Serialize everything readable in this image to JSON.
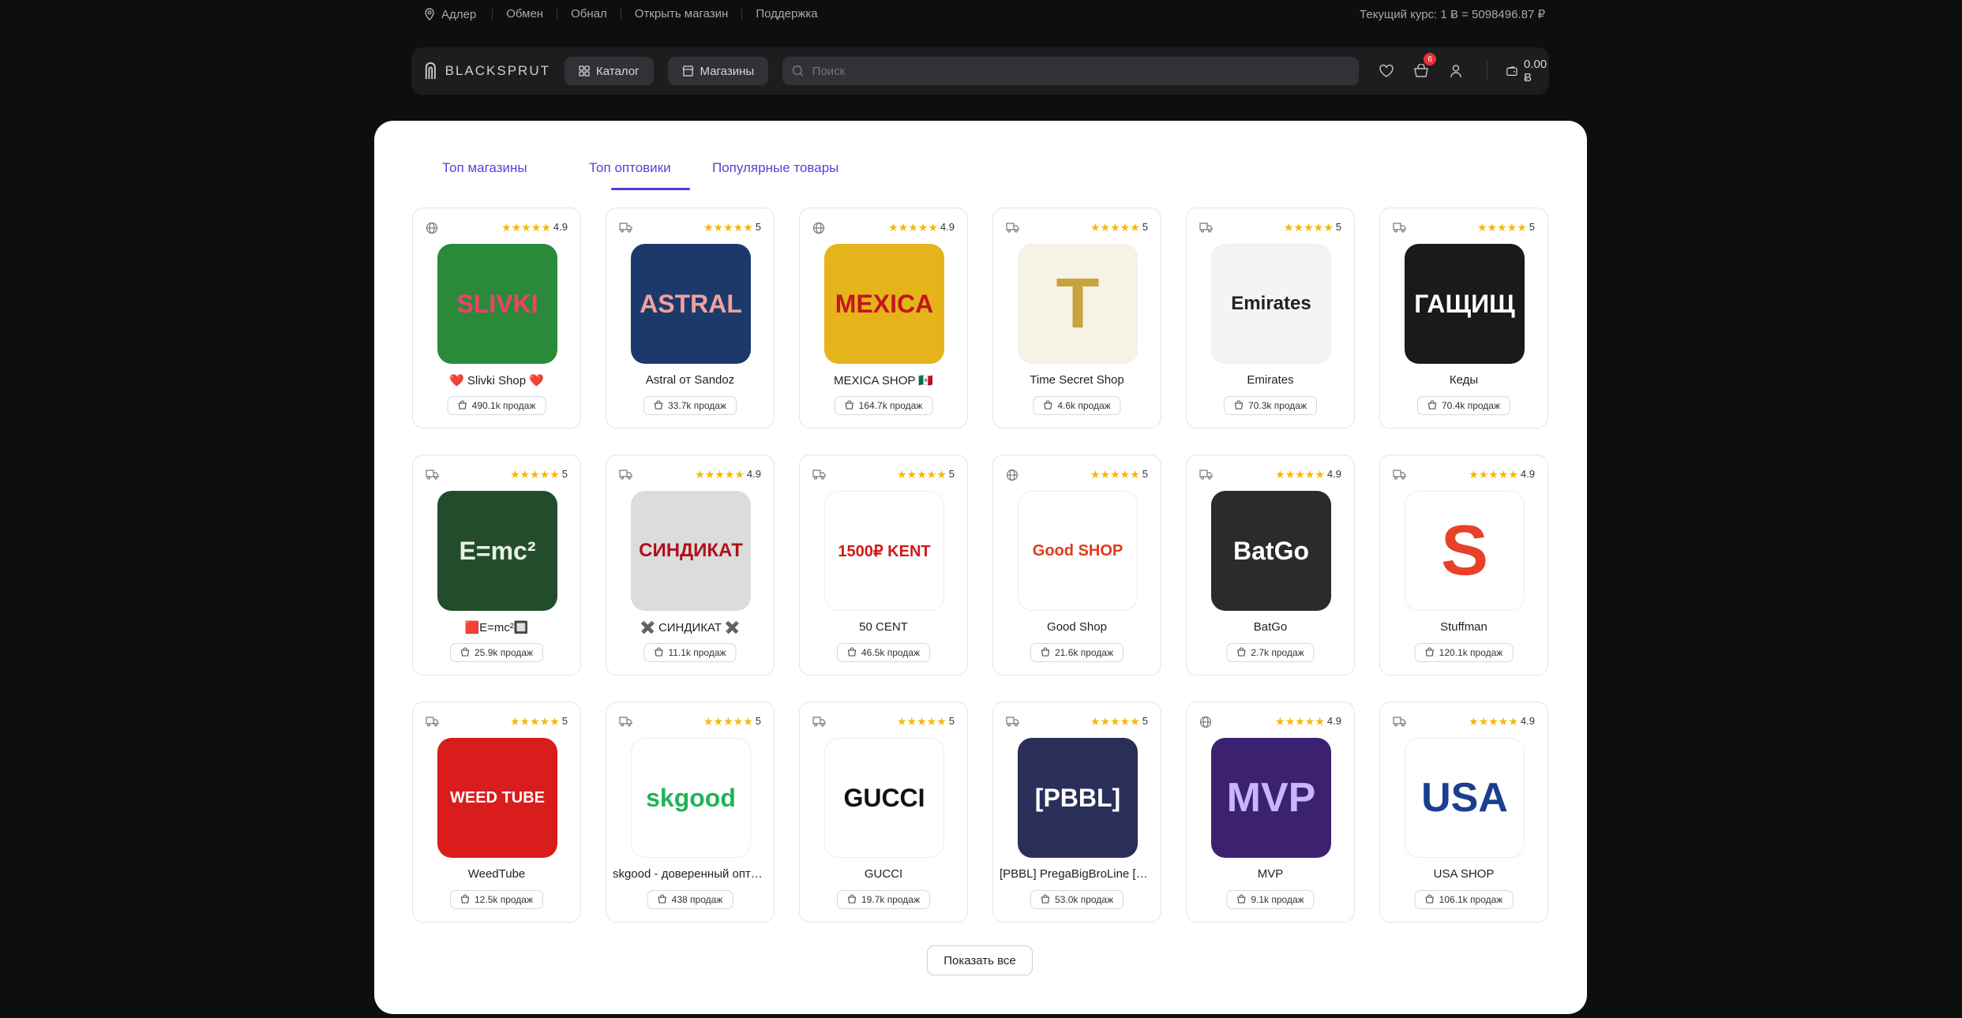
{
  "topbar": {
    "location": "Адлер",
    "links": [
      "Обмен",
      "Обнал",
      "Открыть магазин",
      "Поддержка"
    ],
    "rate": "Текущий курс: 1 Ƀ = 5098496.87 ₽"
  },
  "header": {
    "logo": "BLACKSPRUT",
    "catalog": "Каталог",
    "shops": "Магазины",
    "search_placeholder": "Поиск",
    "cart_badge": "6",
    "balance": "0.00 Ƀ"
  },
  "tabs": [
    "Топ магазины",
    "Топ оптовики",
    "Популярные товары"
  ],
  "active_tab": 1,
  "stars": "★★★★★",
  "cards": [
    {
      "name": "❤️ Slivki Shop ❤️",
      "rating": "4.9",
      "sales": "490.1k продаж",
      "type": "globe",
      "thumb_text": "SLIVKI",
      "bg": "#2a8a3a",
      "fg": "#ff3b6b"
    },
    {
      "name": "Astral от Sandoz",
      "rating": "5",
      "sales": "33.7k продаж",
      "type": "truck",
      "thumb_text": "ASTRAL",
      "bg": "#1b3a6b",
      "fg": "#f2a0a0"
    },
    {
      "name": "MEXICA SHOP 🇲🇽",
      "rating": "4.9",
      "sales": "164.7k продаж",
      "type": "globe",
      "thumb_text": "MEXICA",
      "bg": "#e5b31a",
      "fg": "#c4161c"
    },
    {
      "name": "Time Secret Shop",
      "rating": "5",
      "sales": "4.6k продаж",
      "type": "truck",
      "thumb_text": "T",
      "bg": "#f7f2e6",
      "fg": "#c9a33b"
    },
    {
      "name": "Emirates",
      "rating": "5",
      "sales": "70.3k продаж",
      "type": "truck",
      "thumb_text": "Emirates",
      "bg": "#f4f4f4",
      "fg": "#222"
    },
    {
      "name": "Кеды",
      "rating": "5",
      "sales": "70.4k продаж",
      "type": "truck",
      "thumb_text": "ГАЩИЩ",
      "bg": "#1a1a1a",
      "fg": "#fff"
    },
    {
      "name": "🟥E=mc²🔲",
      "rating": "5",
      "sales": "25.9k продаж",
      "type": "truck",
      "thumb_text": "E=mc²",
      "bg": "#234d2a",
      "fg": "#e8f0e8"
    },
    {
      "name": "✖️ СИНДИКАТ ✖️",
      "rating": "4.9",
      "sales": "11.1k продаж",
      "type": "truck",
      "thumb_text": "СИНДИКАТ",
      "bg": "#dcdcdc",
      "fg": "#b0101a"
    },
    {
      "name": "50 CENT",
      "rating": "5",
      "sales": "46.5k продаж",
      "type": "truck",
      "thumb_text": "1500₽ KENT",
      "bg": "#ffffff",
      "fg": "#d01818"
    },
    {
      "name": "Good Shop",
      "rating": "5",
      "sales": "21.6k продаж",
      "type": "globe",
      "thumb_text": "Good SHOP",
      "bg": "#ffffff",
      "fg": "#e23a1a"
    },
    {
      "name": "BatGo",
      "rating": "4.9",
      "sales": "2.7k продаж",
      "type": "truck",
      "thumb_text": "BatGo",
      "bg": "#2b2b2b",
      "fg": "#ffffff"
    },
    {
      "name": "Stuffman",
      "rating": "4.9",
      "sales": "120.1k продаж",
      "type": "truck",
      "thumb_text": "S",
      "bg": "#ffffff",
      "fg": "#e8412a"
    },
    {
      "name": "WeedTube",
      "rating": "5",
      "sales": "12.5k продаж",
      "type": "truck",
      "thumb_text": "WEED TUBE",
      "bg": "#d91c1c",
      "fg": "#ffffff"
    },
    {
      "name": "skgood - доверенный оптовик",
      "rating": "5",
      "sales": "438 продаж",
      "type": "truck",
      "thumb_text": "skgood",
      "bg": "#ffffff",
      "fg": "#22b35a"
    },
    {
      "name": "GUCCI",
      "rating": "5",
      "sales": "19.7k продаж",
      "type": "truck",
      "thumb_text": "GUCCI",
      "bg": "#ffffff",
      "fg": "#111111"
    },
    {
      "name": "[PBBL] PregaBigBroLine [Прега]",
      "rating": "5",
      "sales": "53.0k продаж",
      "type": "truck",
      "thumb_text": "[PBBL]",
      "bg": "#2a2f5a",
      "fg": "#ffffff"
    },
    {
      "name": "MVP",
      "rating": "4.9",
      "sales": "9.1k продаж",
      "type": "globe",
      "thumb_text": "MVP",
      "bg": "#3b2170",
      "fg": "#c9b4ff"
    },
    {
      "name": "USA SHOP",
      "rating": "4.9",
      "sales": "106.1k продаж",
      "type": "truck",
      "thumb_text": "USA",
      "bg": "#ffffff",
      "fg": "#1b3f8f"
    }
  ],
  "show_all": "Показать все",
  "colors": {
    "accent": "#4b3ed8",
    "star": "#f5b800",
    "badge": "#e5313b"
  }
}
